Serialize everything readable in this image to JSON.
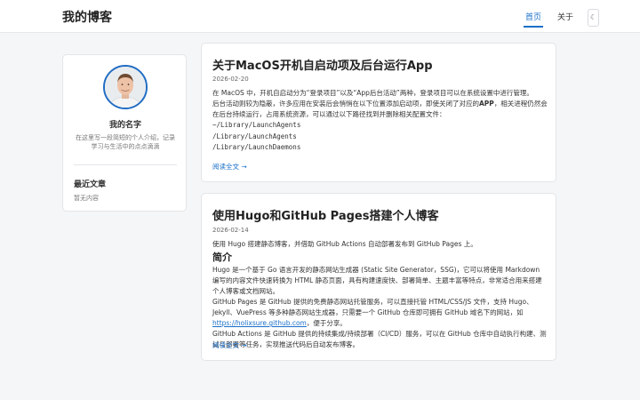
{
  "header": {
    "site_title": "我的博客",
    "nav": [
      {
        "label": "首页",
        "active": true
      },
      {
        "label": "关于",
        "active": false
      }
    ],
    "theme_toggle": "☾"
  },
  "profile": {
    "name": "我的名字",
    "bio": "在这里写一段简短的个人介绍，记录学习与生活中的点点滴滴",
    "section_title": "最近文章",
    "section_text": "暂无内容"
  },
  "posts": [
    {
      "title": "关于MacOS开机自启动项及后台运行App",
      "date": "2026-02-20",
      "intro": "在 MacOS 中，开机自启动分为“登录项目”以及“App后台活动”两种，登录项目可以在系统设置中进行管理。",
      "body_pre": "后台活动则较为隐蔽，许多应用在安装后会悄悄在以下位置添加启动项，即使关闭了对应的",
      "body_strong": "APP",
      "body_post": "，相关进程仍然会在后台持续运行，占用系统资源，可以通过以下路径找到并删除相关配置文件：",
      "paths": [
        "~/Library/LaunchAgents",
        "/Library/LaunchAgents",
        "/Library/LaunchDaemons"
      ],
      "read_more": "阅读全文 →"
    },
    {
      "title": "使用Hugo和GitHub Pages搭建个人博客",
      "date": "2026-02-14",
      "intro": "使用 Hugo 搭建静态博客，并借助 GitHub Actions 自动部署发布到 GitHub Pages 上。",
      "heading": "简介",
      "para1": "Hugo 是一个基于 Go 语言开发的静态网站生成器 (Static Site Generator，SSG)，它可以将使用 Markdown 编写的内容文件快速转换为 HTML 静态页面，具有构建速度快、部署简单、主题丰富等特点，非常适合用来搭建个人博客或文档网站。",
      "para2_pre": "GitHub Pages 是 GitHub 提供的免费静态网站托管服务，可以直接托管 HTML/CSS/JS 文件，支持 Hugo、Jekyll、VuePress 等多种静态网站生成器，只需要一个 GitHub 仓库即可拥有 GitHub 域名下的网站，如 ",
      "para2_link": "https://holixsure.github.com",
      "para2_post": "，便于分享。",
      "para3": "GitHub Actions 是 GitHub 提供的持续集成/持续部署（CI/CD）服务，可以在 GitHub 仓库中自动执行构建、测试与部署等任务，实现推送代码后自动发布博客。",
      "read_more": "阅读全文 →"
    }
  ]
}
